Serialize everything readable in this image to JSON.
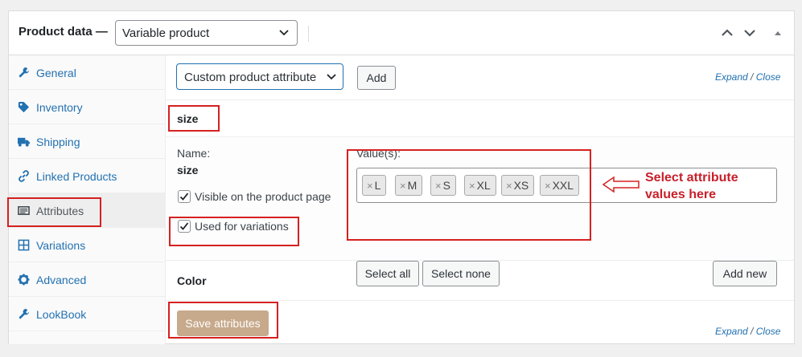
{
  "header": {
    "title": "Product data —",
    "product_type": "Variable product"
  },
  "sidebar": {
    "items": [
      {
        "label": "General",
        "icon": "wrench-icon"
      },
      {
        "label": "Inventory",
        "icon": "tag-icon"
      },
      {
        "label": "Shipping",
        "icon": "truck-icon"
      },
      {
        "label": "Linked Products",
        "icon": "link-icon"
      },
      {
        "label": "Attributes",
        "icon": "list-icon",
        "active": true
      },
      {
        "label": "Variations",
        "icon": "grid-icon"
      },
      {
        "label": "Advanced",
        "icon": "gear-icon"
      },
      {
        "label": "LookBook",
        "icon": "wrench-icon"
      }
    ]
  },
  "toolbar": {
    "attribute_select": "Custom product attribute",
    "add_label": "Add",
    "expand": "Expand",
    "separator": "/",
    "close": "Close"
  },
  "attribute": {
    "header_name": "size",
    "name_label": "Name:",
    "name_value": "size",
    "visible_label": "Visible on the product page",
    "variations_label": "Used for variations",
    "values_label": "Value(s):",
    "values": [
      "L",
      "M",
      "S",
      "XL",
      "XS",
      "XXL"
    ],
    "chip_remove": "×",
    "select_all": "Select all",
    "select_none": "Select none",
    "add_new": "Add new"
  },
  "color_attribute": {
    "name": "Color"
  },
  "footer": {
    "save_label": "Save attributes",
    "expand": "Expand",
    "separator": "/",
    "close": "Close"
  },
  "annotation": {
    "line1": "Select attribute",
    "line2": "values here"
  },
  "colors": {
    "accent": "#2271b1",
    "annotation_red": "#d62020",
    "save_button": "#c7a98b"
  }
}
